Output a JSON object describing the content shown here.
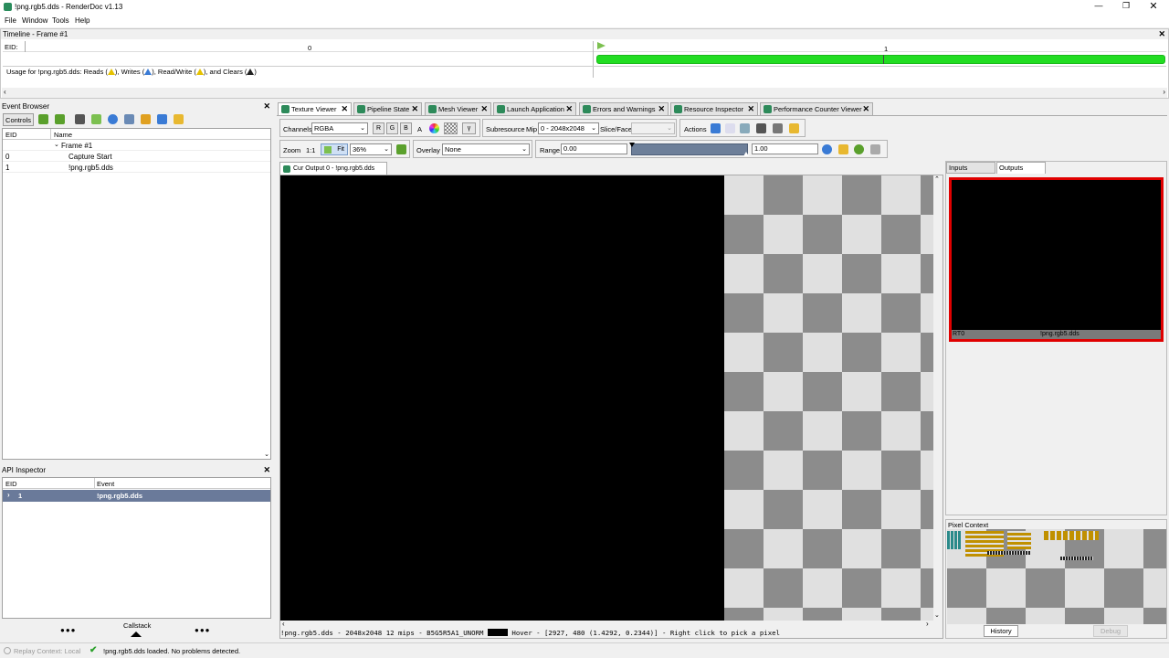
{
  "window": {
    "title": "!png.rgb5.dds - RenderDoc v1.13"
  },
  "menu": {
    "file": "File",
    "window": "Window",
    "tools": "Tools",
    "help": "Help"
  },
  "timeline": {
    "title": "Timeline - Frame #1",
    "eid_label": "EID:",
    "marker_0": "0",
    "marker_1": "1",
    "usage_text": "Usage for !png.rgb5.dds: Reads (",
    "writes_text": "), Writes (",
    "readwrite_text": "), Read/Write (",
    "clears_text": "), and Clears ("
  },
  "event_browser": {
    "title": "Event Browser",
    "controls_label": "Controls",
    "col_eid": "EID",
    "col_name": "Name",
    "rows": [
      {
        "eid": "",
        "name": "Frame #1"
      },
      {
        "eid": "0",
        "name": "Capture Start"
      },
      {
        "eid": "1",
        "name": "!png.rgb5.dds"
      }
    ]
  },
  "api_inspector": {
    "title": "API Inspector",
    "col_eid": "EID",
    "col_event": "Event",
    "row_eid": "1",
    "row_event": "!png.rgb5.dds",
    "callstack": "Callstack",
    "dots": "●●●"
  },
  "tabs": {
    "texture_viewer": "Texture Viewer",
    "pipeline_state": "Pipeline State",
    "mesh_viewer": "Mesh Viewer",
    "launch_application": "Launch Application",
    "errors_warnings": "Errors and Warnings",
    "resource_inspector": "Resource Inspector",
    "perf_counter": "Performance Counter Viewer"
  },
  "toolbar": {
    "channels_label": "Channels",
    "channels_value": "RGBA",
    "r": "R",
    "g": "G",
    "b": "B",
    "a": "A",
    "gamma": "γ",
    "subresource_label": "Subresource",
    "mip_label": "Mip",
    "mip_value": "0 - 2048x2048",
    "slice_label": "Slice/Face",
    "actions_label": "Actions",
    "zoom_label": "Zoom",
    "zoom_1to1": "1:1",
    "fit_label": "Fit",
    "zoom_value": "36%",
    "overlay_label": "Overlay",
    "overlay_value": "None",
    "range_label": "Range",
    "range_min": "0.00",
    "range_max": "1.00"
  },
  "texture": {
    "tab_label": "Cur Output 0 - !png.rgb5.dds",
    "status": "!png.rgb5.dds - 2048x2048 12 mips - B5G5R5A1_UNORM",
    "hover": "Hover - [2927,  480 (1.4292, 0.2344)] - Right click to pick a pixel"
  },
  "thumbs": {
    "inputs_tab": "Inputs",
    "outputs_tab": "Outputs",
    "rt_label": "RT0",
    "rt_name": "!png.rgb5.dds"
  },
  "pixel_context": {
    "title": "Pixel Context",
    "history": "History",
    "debug": "Debug"
  },
  "statusbar": {
    "replay_context": "Replay Context: Local",
    "message": "!png.rgb5.dds loaded. No problems detected."
  },
  "colors": {
    "timeline_bar": "#22dd22",
    "selection_row": "#6a7a9a",
    "thumb_border": "#e00000"
  }
}
